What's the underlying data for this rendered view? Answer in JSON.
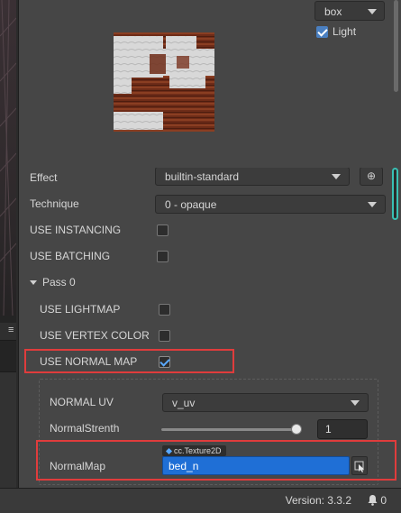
{
  "left_strip": {
    "menu_glyph": "≡"
  },
  "preview": {
    "mesh_select": "box",
    "light_label": "Light",
    "light_checked": true
  },
  "properties": {
    "effect": {
      "label": "Effect",
      "value": "builtin-standard",
      "locate_icon": "locate-icon"
    },
    "technique": {
      "label": "Technique",
      "value": "0 - opaque"
    },
    "use_instancing": {
      "label": "USE INSTANCING",
      "checked": false
    },
    "use_batching": {
      "label": "USE BATCHING",
      "checked": false
    }
  },
  "pass": {
    "header": "Pass 0",
    "use_lightmap": {
      "label": "USE LIGHTMAP",
      "checked": false
    },
    "use_vertex_color": {
      "label": "USE VERTEX COLOR",
      "checked": false
    },
    "use_normal_map": {
      "label": "USE NORMAL MAP",
      "checked": true
    },
    "normal_uv": {
      "label": "NORMAL UV",
      "value": "v_uv"
    },
    "normal_strength": {
      "label": "NormalStrenth",
      "value": "1",
      "slider_fraction": 1.0
    },
    "normal_map": {
      "label": "NormalMap",
      "type_tag": "cc.Texture2D",
      "value": "bed_n"
    }
  },
  "status_bar": {
    "version": "Version: 3.3.2",
    "notification_count": "0"
  },
  "colors": {
    "highlight_box": "#e03c3c",
    "asset_field": "#1f6fd6",
    "scroll_accent": "#39c0b4"
  }
}
